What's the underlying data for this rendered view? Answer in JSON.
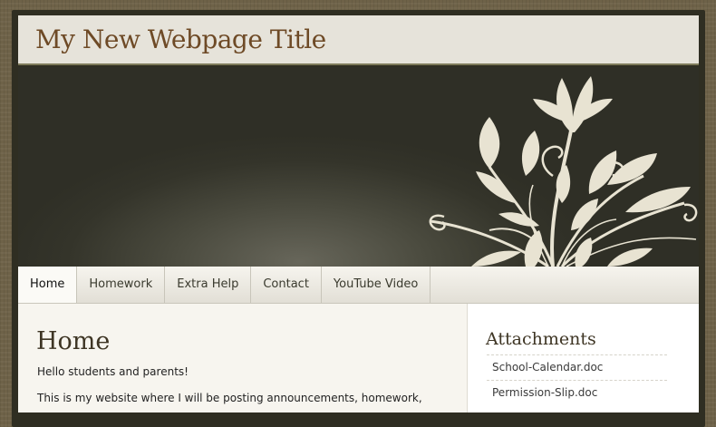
{
  "header": {
    "site_title": "My New Webpage Title"
  },
  "nav": {
    "items": [
      {
        "label": "Home",
        "active": true
      },
      {
        "label": "Homework",
        "active": false
      },
      {
        "label": "Extra Help",
        "active": false
      },
      {
        "label": "Contact",
        "active": false
      },
      {
        "label": "YouTube Video",
        "active": false
      }
    ]
  },
  "main": {
    "heading": "Home",
    "intro": "Hello students and parents!",
    "paragraph": "This is my website where I will be posting announcements, homework,"
  },
  "sidebar": {
    "heading": "Attachments",
    "attachments": [
      "School-Calendar.doc",
      "Permission-Slip.doc"
    ]
  },
  "colors": {
    "title_text": "#6e4a26",
    "banner_dark": "#2f2f26",
    "flower": "#e8e3d2"
  }
}
